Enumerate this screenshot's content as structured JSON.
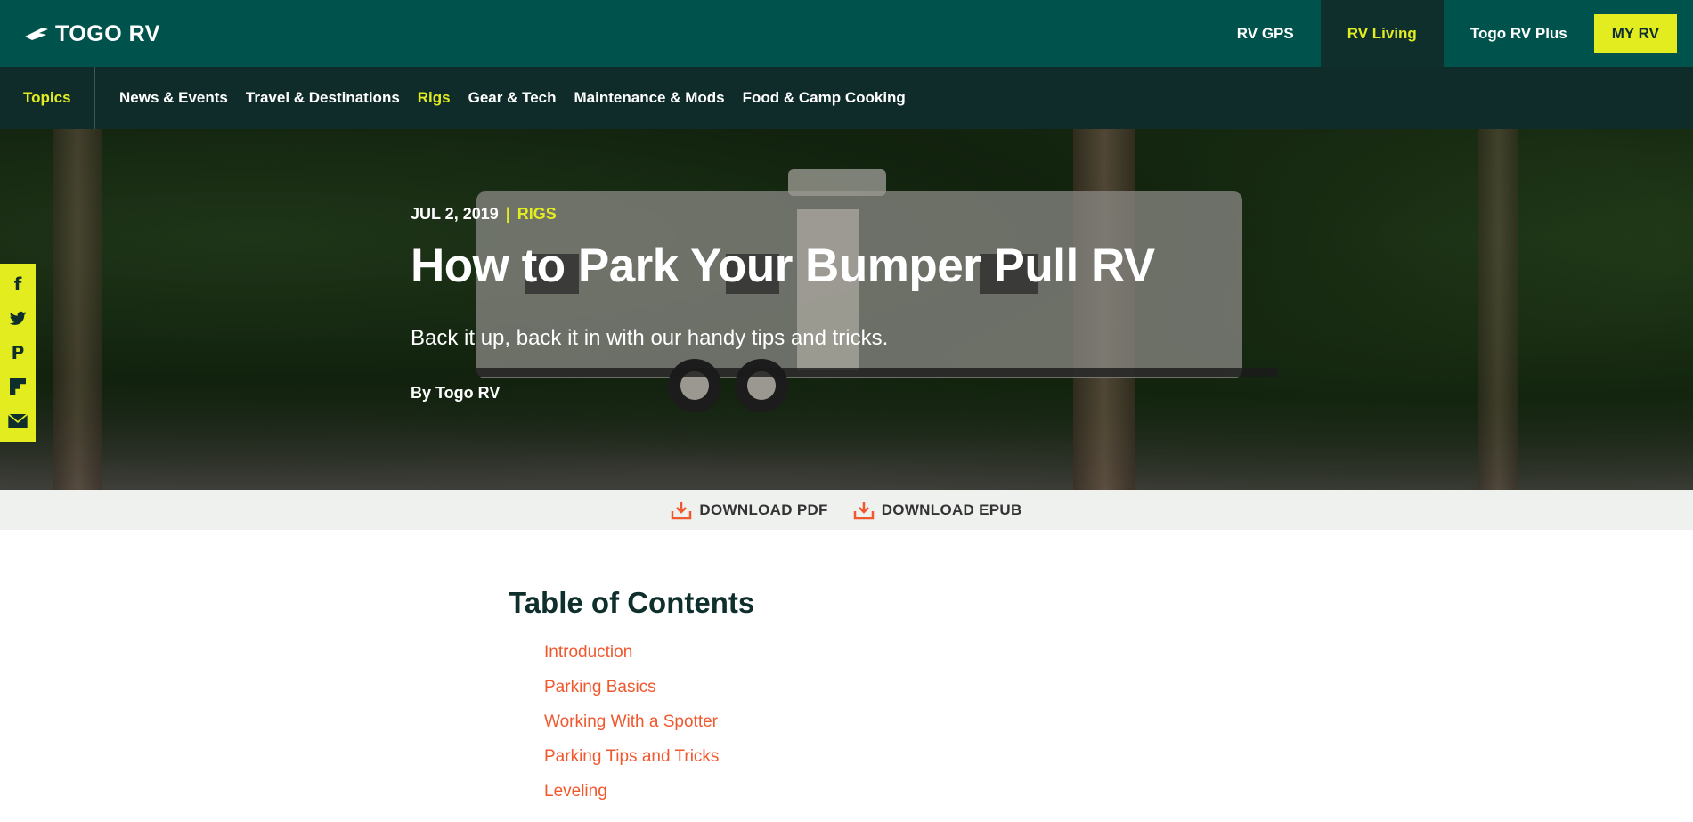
{
  "brand": {
    "name": "TOGO RV"
  },
  "topnav": {
    "items": [
      {
        "label": "RV GPS"
      },
      {
        "label": "RV Living"
      },
      {
        "label": "Togo RV Plus"
      },
      {
        "label": "MY RV"
      }
    ]
  },
  "topics": {
    "label": "Topics",
    "links": [
      {
        "label": "News & Events"
      },
      {
        "label": "Travel & Destinations"
      },
      {
        "label": "Rigs"
      },
      {
        "label": "Gear & Tech"
      },
      {
        "label": "Maintenance & Mods"
      },
      {
        "label": "Food & Camp Cooking"
      }
    ]
  },
  "article": {
    "date": "JUL 2, 2019",
    "separator": "|",
    "category": "RIGS",
    "title": "How to Park Your Bumper Pull RV",
    "subtitle": "Back it up, back it in with our handy tips and tricks.",
    "byline": "By Togo RV"
  },
  "social": {
    "icons": [
      "facebook-icon",
      "twitter-icon",
      "pinterest-icon",
      "flipboard-icon",
      "email-icon"
    ],
    "glyphs": [
      "f",
      "🐦",
      "P",
      "F",
      "✉"
    ]
  },
  "downloads": {
    "pdf": "DOWNLOAD PDF",
    "epub": "DOWNLOAD EPUB"
  },
  "toc": {
    "title": "Table of Contents",
    "items": [
      "Introduction",
      "Parking Basics",
      "Working With a Spotter",
      "Parking Tips and Tricks",
      "Leveling"
    ]
  },
  "colors": {
    "header": "#00524c",
    "topics_bar": "#0f2c2a",
    "accent_yellow": "#e2ec1f",
    "link_orange": "#f0582e"
  }
}
